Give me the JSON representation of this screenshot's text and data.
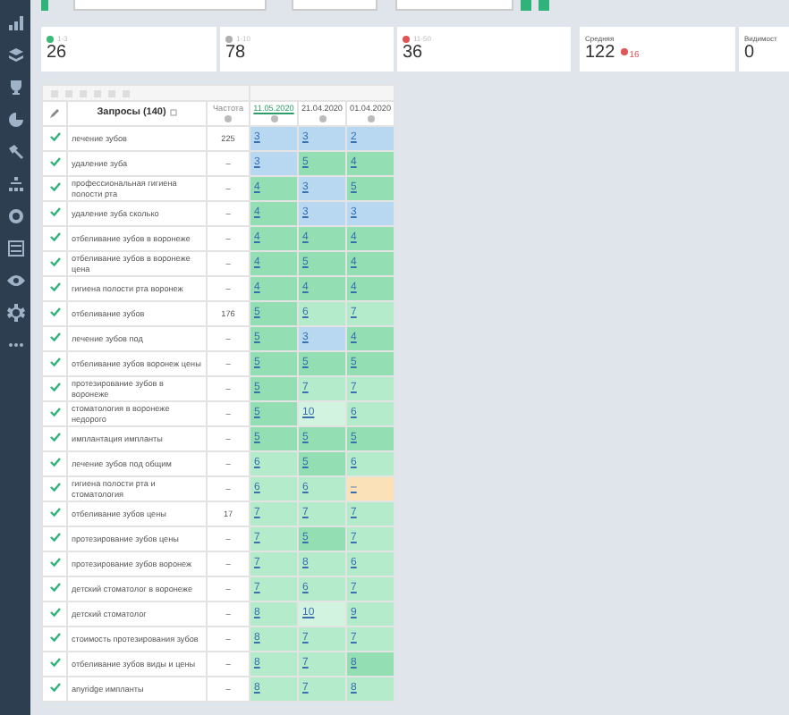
{
  "summary_cards": [
    {
      "label": "1-3",
      "value": "26",
      "color": "#3cb878"
    },
    {
      "label": "1-10",
      "value": "78",
      "color": "#b0b0b0"
    },
    {
      "label": "11-50",
      "value": "36",
      "color": "#e05555"
    }
  ],
  "average": {
    "label": "Средняя",
    "value": "122",
    "change": "16"
  },
  "visibility": {
    "label": "Видимост",
    "value": "0"
  },
  "table": {
    "query_header": "Запросы (140)",
    "frequency_header": "Частота",
    "dates": [
      {
        "label": "11.05.2020",
        "selected": true
      },
      {
        "label": "21.04.2020",
        "selected": false
      },
      {
        "label": "01.04.2020",
        "selected": false
      }
    ],
    "rows": [
      {
        "checked": true,
        "query": "лечение зубов",
        "frequency": "225",
        "positions": [
          {
            "value": "3",
            "color": "#b8d8f2"
          },
          {
            "value": "3",
            "color": "#b8d8f2"
          },
          {
            "value": "2",
            "color": "#b8d8f2"
          }
        ]
      },
      {
        "checked": true,
        "query": "удаление зуба",
        "frequency": "–",
        "positions": [
          {
            "value": "3",
            "color": "#b8d8f2"
          },
          {
            "value": "5",
            "color": "#93deb3"
          },
          {
            "value": "4",
            "color": "#93deb3"
          }
        ]
      },
      {
        "checked": true,
        "query": "профессиональная гигиена полости рта",
        "frequency": "–",
        "positions": [
          {
            "value": "4",
            "color": "#93deb3"
          },
          {
            "value": "3",
            "color": "#b8d8f2"
          },
          {
            "value": "5",
            "color": "#93deb3"
          }
        ]
      },
      {
        "checked": true,
        "query": "удаление зуба сколько",
        "frequency": "–",
        "positions": [
          {
            "value": "4",
            "color": "#93deb3"
          },
          {
            "value": "3",
            "color": "#b8d8f2"
          },
          {
            "value": "3",
            "color": "#b8d8f2"
          }
        ]
      },
      {
        "checked": true,
        "query": "отбеливание зубов в воронеже",
        "frequency": "–",
        "positions": [
          {
            "value": "4",
            "color": "#93deb3"
          },
          {
            "value": "4",
            "color": "#93deb3"
          },
          {
            "value": "4",
            "color": "#93deb3"
          }
        ]
      },
      {
        "checked": true,
        "query": "отбеливание зубов в воронеже цена",
        "frequency": "–",
        "positions": [
          {
            "value": "4",
            "color": "#93deb3"
          },
          {
            "value": "5",
            "color": "#93deb3"
          },
          {
            "value": "4",
            "color": "#93deb3"
          }
        ]
      },
      {
        "checked": true,
        "query": "гигиена полости рта воронеж",
        "frequency": "–",
        "positions": [
          {
            "value": "4",
            "color": "#93deb3"
          },
          {
            "value": "4",
            "color": "#93deb3"
          },
          {
            "value": "4",
            "color": "#93deb3"
          }
        ]
      },
      {
        "checked": true,
        "query": "отбеливание зубов",
        "frequency": "176",
        "positions": [
          {
            "value": "5",
            "color": "#93deb3"
          },
          {
            "value": "6",
            "color": "#b4ebcb"
          },
          {
            "value": "7",
            "color": "#b4ebcb"
          }
        ]
      },
      {
        "checked": true,
        "query": "лечение зубов под",
        "frequency": "–",
        "positions": [
          {
            "value": "5",
            "color": "#93deb3"
          },
          {
            "value": "3",
            "color": "#b8d8f2"
          },
          {
            "value": "4",
            "color": "#93deb3"
          }
        ]
      },
      {
        "checked": true,
        "query": "отбеливание зубов воронеж цены",
        "frequency": "–",
        "positions": [
          {
            "value": "5",
            "color": "#93deb3"
          },
          {
            "value": "5",
            "color": "#93deb3"
          },
          {
            "value": "5",
            "color": "#93deb3"
          }
        ]
      },
      {
        "checked": true,
        "query": "протезирование зубов в воронеже",
        "frequency": "–",
        "positions": [
          {
            "value": "5",
            "color": "#93deb3"
          },
          {
            "value": "7",
            "color": "#b4ebcb"
          },
          {
            "value": "7",
            "color": "#b4ebcb"
          }
        ]
      },
      {
        "checked": true,
        "query": "стоматология в воронеже недорого",
        "frequency": "–",
        "positions": [
          {
            "value": "5",
            "color": "#93deb3"
          },
          {
            "value": "10",
            "color": "#d3f3e1"
          },
          {
            "value": "6",
            "color": "#b4ebcb"
          }
        ]
      },
      {
        "checked": true,
        "query": "имплантация импланты",
        "frequency": "–",
        "positions": [
          {
            "value": "5",
            "color": "#93deb3"
          },
          {
            "value": "5",
            "color": "#93deb3"
          },
          {
            "value": "5",
            "color": "#93deb3"
          }
        ]
      },
      {
        "checked": true,
        "query": "лечение зубов под общим",
        "frequency": "–",
        "positions": [
          {
            "value": "6",
            "color": "#b4ebcb"
          },
          {
            "value": "5",
            "color": "#93deb3"
          },
          {
            "value": "6",
            "color": "#b4ebcb"
          }
        ]
      },
      {
        "checked": true,
        "query": "гигиена полости рта и стоматология",
        "frequency": "–",
        "positions": [
          {
            "value": "6",
            "color": "#b4ebcb"
          },
          {
            "value": "6",
            "color": "#b4ebcb"
          },
          {
            "value": "–",
            "color": "#fbe1b8"
          }
        ]
      },
      {
        "checked": true,
        "query": "отбеливание зубов цены",
        "frequency": "17",
        "positions": [
          {
            "value": "7",
            "color": "#b4ebcb"
          },
          {
            "value": "7",
            "color": "#b4ebcb"
          },
          {
            "value": "7",
            "color": "#b4ebcb"
          }
        ]
      },
      {
        "checked": true,
        "query": "протезирование зубов цены",
        "frequency": "–",
        "positions": [
          {
            "value": "7",
            "color": "#b4ebcb"
          },
          {
            "value": "5",
            "color": "#93deb3"
          },
          {
            "value": "7",
            "color": "#b4ebcb"
          }
        ]
      },
      {
        "checked": true,
        "query": "протезирование зубов воронеж",
        "frequency": "–",
        "positions": [
          {
            "value": "7",
            "color": "#b4ebcb"
          },
          {
            "value": "8",
            "color": "#b4ebcb"
          },
          {
            "value": "6",
            "color": "#b4ebcb"
          }
        ]
      },
      {
        "checked": true,
        "query": "детский стоматолог в воронеже",
        "frequency": "–",
        "positions": [
          {
            "value": "7",
            "color": "#b4ebcb"
          },
          {
            "value": "6",
            "color": "#b4ebcb"
          },
          {
            "value": "7",
            "color": "#b4ebcb"
          }
        ]
      },
      {
        "checked": true,
        "query": "детский стоматолог",
        "frequency": "–",
        "positions": [
          {
            "value": "8",
            "color": "#b4ebcb"
          },
          {
            "value": "10",
            "color": "#d3f3e1"
          },
          {
            "value": "9",
            "color": "#b4ebcb"
          }
        ]
      },
      {
        "checked": true,
        "query": "стоимость протезирования зубов",
        "frequency": "–",
        "positions": [
          {
            "value": "8",
            "color": "#b4ebcb"
          },
          {
            "value": "7",
            "color": "#b4ebcb"
          },
          {
            "value": "7",
            "color": "#b4ebcb"
          }
        ]
      },
      {
        "checked": true,
        "query": "отбеливание зубов виды и цены",
        "frequency": "–",
        "positions": [
          {
            "value": "8",
            "color": "#b4ebcb"
          },
          {
            "value": "7",
            "color": "#b4ebcb"
          },
          {
            "value": "8",
            "color": "#93deb3"
          }
        ]
      },
      {
        "checked": true,
        "query": "anyridge импланты",
        "frequency": "–",
        "positions": [
          {
            "value": "8",
            "color": "#b4ebcb"
          },
          {
            "value": "7",
            "color": "#b4ebcb"
          },
          {
            "value": "8",
            "color": "#b4ebcb"
          }
        ]
      }
    ]
  }
}
